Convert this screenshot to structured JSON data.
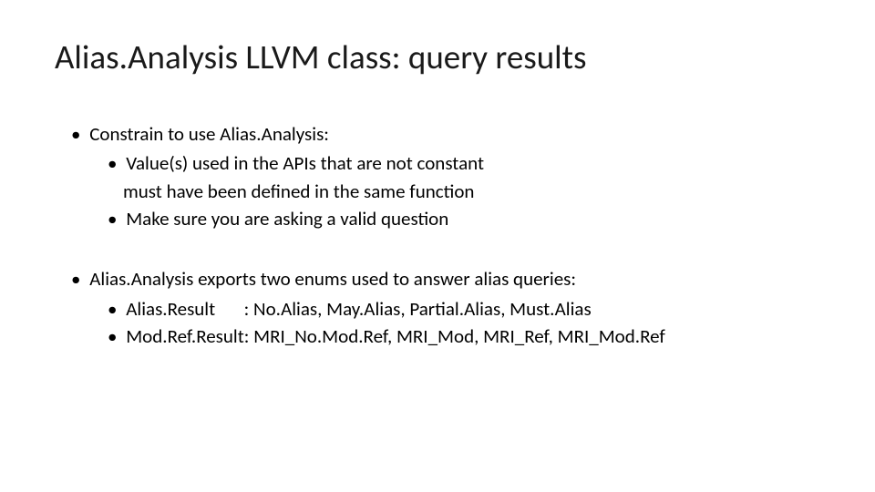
{
  "title": "Alias.Analysis LLVM class: query results",
  "b1": "Constrain to use Alias.Analysis:",
  "b1_1": "Value(s) used in the APIs that are not constant",
  "b1_1_cont": "must have been defined in the same function",
  "b1_2": "Make sure you are asking a valid question",
  "b2": "Alias.Analysis exports two enums used to answer alias queries:",
  "b2_1": "Alias.Result  : No.Alias, May.Alias, Partial.Alias, Must.Alias",
  "b2_2": "Mod.Ref.Result: MRI_No.Mod.Ref, MRI_Mod, MRI_Ref, MRI_Mod.Ref"
}
